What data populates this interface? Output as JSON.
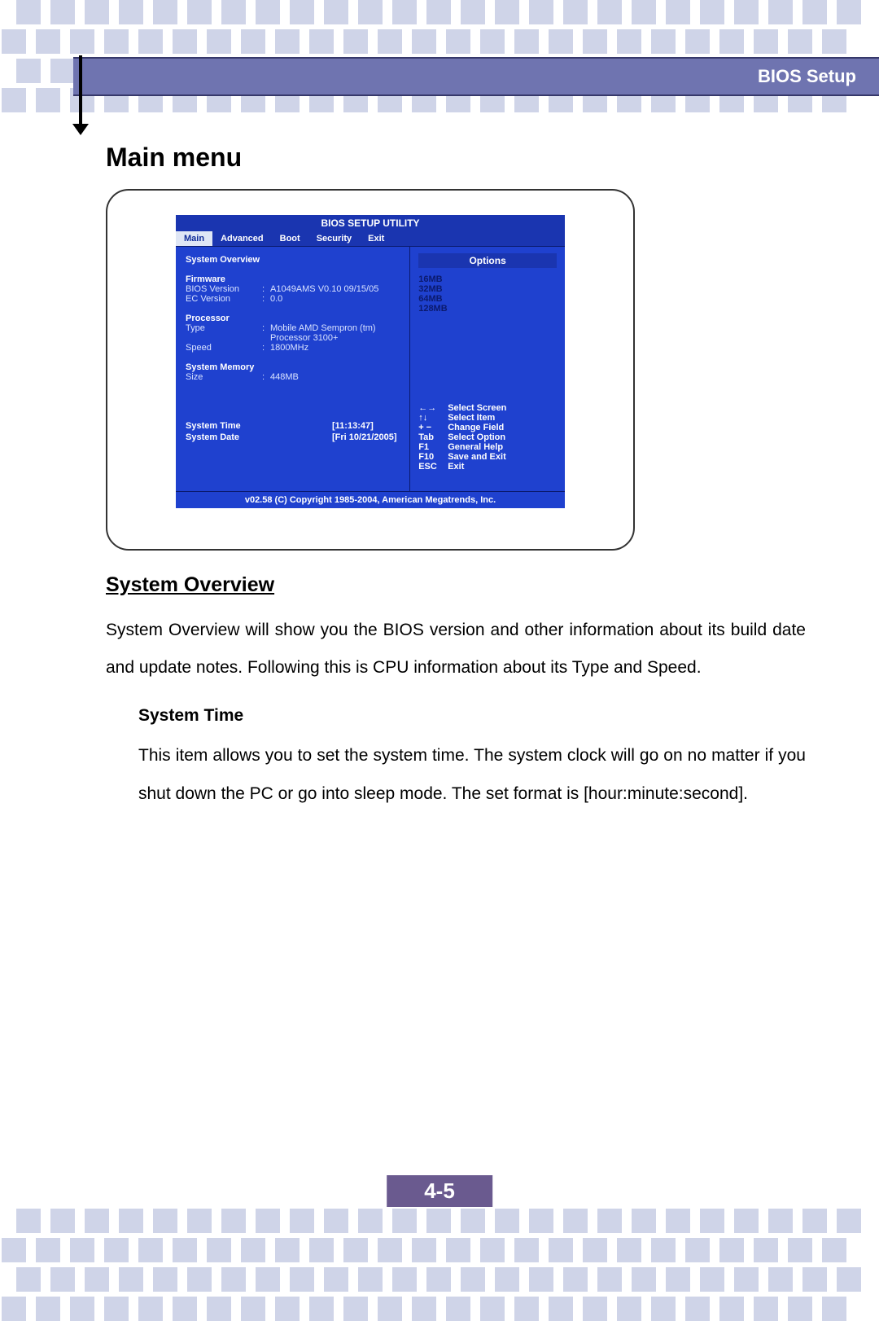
{
  "header": {
    "title": "BIOS Setup"
  },
  "page_title": "Main menu",
  "bios": {
    "utility_title": "BIOS SETUP UTILITY",
    "tabs": [
      "Main",
      "Advanced",
      "Boot",
      "Security",
      "Exit"
    ],
    "active_tab": "Main",
    "section_overview": "System Overview",
    "firmware_header": "Firmware",
    "firmware_rows": [
      {
        "label": "BIOS Version",
        "value": "A1049AMS  V0.10  09/15/05"
      },
      {
        "label": "EC    Version",
        "value": "0.0"
      }
    ],
    "processor_header": "Processor",
    "processor_rows": [
      {
        "label": "Type",
        "value": "Mobile AMD Sempron (tm) Processor 3100+"
      },
      {
        "label": "Speed",
        "value": "1800MHz"
      }
    ],
    "memory_header": "System Memory",
    "memory_rows": [
      {
        "label": "Size",
        "value": "448MB"
      }
    ],
    "system_time_label": "System Time",
    "system_time_value": "[11:13:47]",
    "system_date_label": "System Date",
    "system_date_value": "[Fri 10/21/2005]",
    "options_header": "Options",
    "options_list": [
      "16MB",
      "32MB",
      "64MB",
      "128MB"
    ],
    "help_keys": [
      {
        "key": "←→",
        "desc": "Select Screen"
      },
      {
        "key": "↑↓",
        "desc": "Select Item"
      },
      {
        "key": "+ −",
        "desc": "Change Field"
      },
      {
        "key": "Tab",
        "desc": "Select Option"
      },
      {
        "key": "F1",
        "desc": "General Help"
      },
      {
        "key": "F10",
        "desc": "Save and Exit"
      },
      {
        "key": "ESC",
        "desc": "Exit"
      }
    ],
    "footer": "v02.58 (C) Copyright  1985-2004, American Megatrends, Inc."
  },
  "body": {
    "h2": "System Overview",
    "p1": "System Overview will show you the BIOS version and other information about its build date and update notes. Following this is CPU information about its Type and Speed.",
    "sub_title": "System Time",
    "sub_p": "This item allows you to set the system time.   The system clock will go on no matter if you shut down the PC or go into sleep mode.   The set format is [hour:minute:second]."
  },
  "page_number": "4-5"
}
